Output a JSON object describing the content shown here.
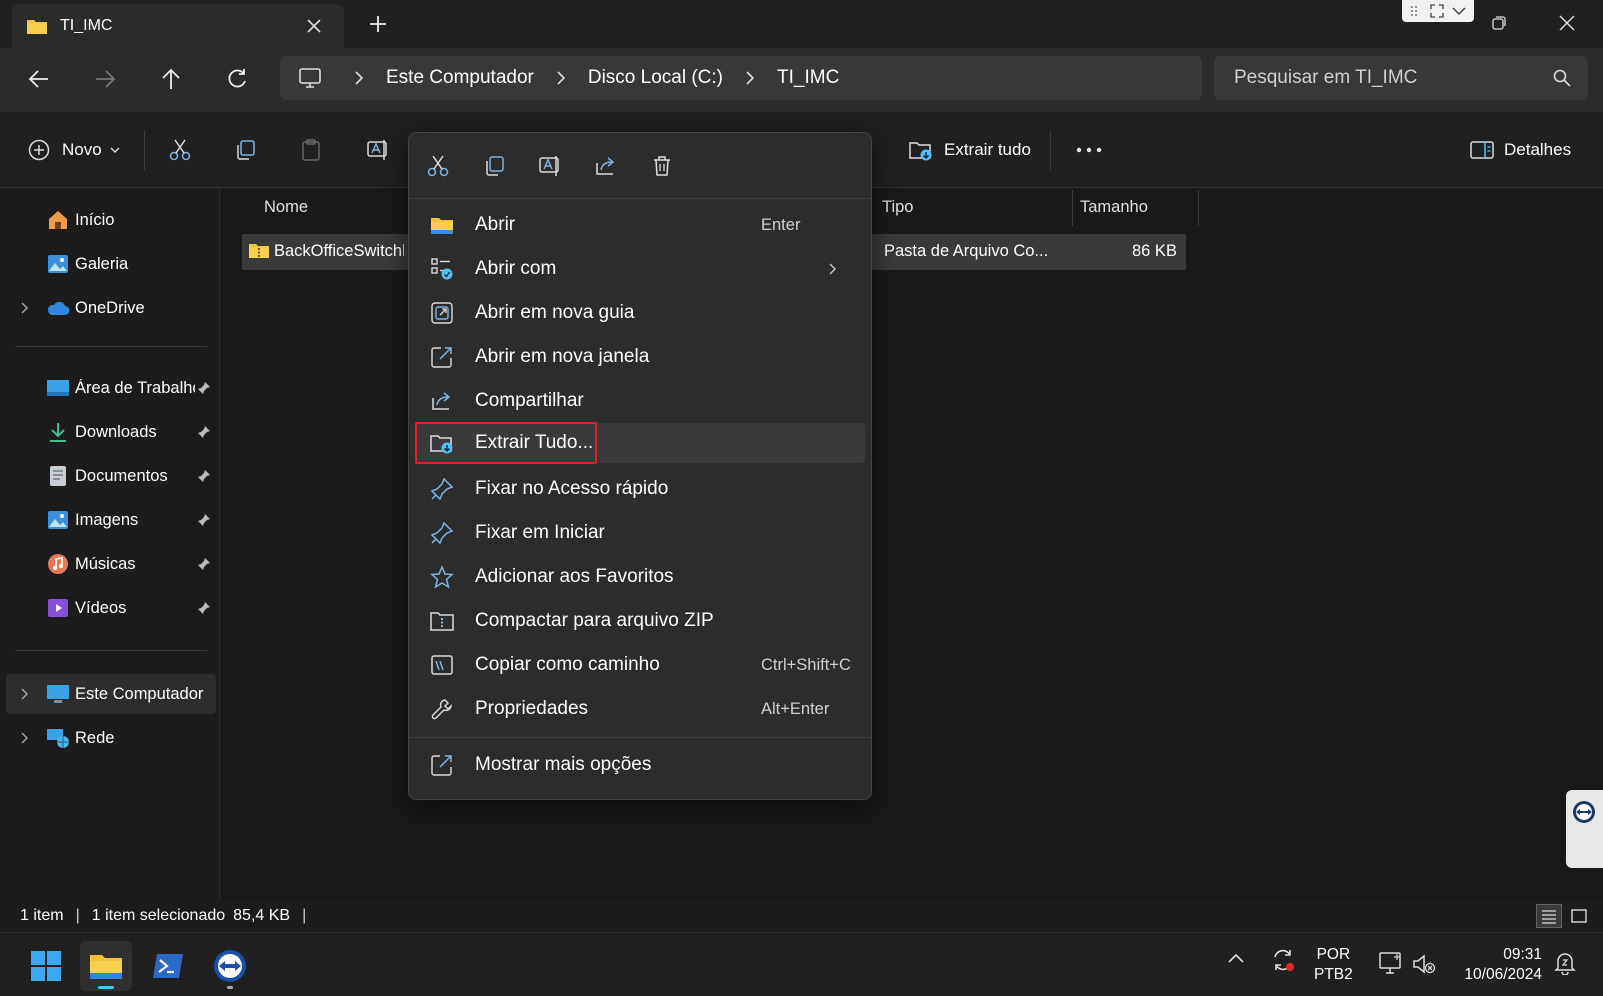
{
  "window": {
    "tab_title": "TI_IMC"
  },
  "address": {
    "crumbs": [
      "Este Computador",
      "Disco Local (C:)",
      "TI_IMC"
    ],
    "search_placeholder": "Pesquisar em TI_IMC"
  },
  "commandbar": {
    "new_label": "Novo",
    "extract_all_label": "Extrair tudo",
    "details_label": "Detalhes"
  },
  "sidebar": {
    "items": [
      {
        "label": "Início"
      },
      {
        "label": "Galeria"
      },
      {
        "label": "OneDrive"
      },
      {
        "label": "Área de Trabalho"
      },
      {
        "label": "Downloads"
      },
      {
        "label": "Documentos"
      },
      {
        "label": "Imagens"
      },
      {
        "label": "Músicas"
      },
      {
        "label": "Vídeos"
      },
      {
        "label": "Este Computador"
      },
      {
        "label": "Rede"
      }
    ]
  },
  "filelist": {
    "columns": [
      "Nome",
      "Tipo",
      "Tamanho"
    ],
    "rows": [
      {
        "name": "BackOfficeSwitchb",
        "type": "Pasta de Arquivo Co...",
        "size": "86 KB"
      }
    ]
  },
  "context_menu": {
    "items": [
      {
        "label": "Abrir",
        "shortcut": "Enter",
        "icon": "folder-icon"
      },
      {
        "label": "Abrir com",
        "shortcut": "",
        "icon": "open-with-icon"
      },
      {
        "label": "Abrir em nova guia",
        "shortcut": "",
        "icon": "new-tab-icon"
      },
      {
        "label": "Abrir em nova janela",
        "shortcut": "",
        "icon": "new-window-icon"
      },
      {
        "label": "Compartilhar",
        "shortcut": "",
        "icon": "share-icon"
      },
      {
        "label": "Extrair Tudo...",
        "shortcut": "",
        "icon": "extract-icon"
      },
      {
        "label": "Fixar no Acesso rápido",
        "shortcut": "",
        "icon": "pin-icon"
      },
      {
        "label": "Fixar em Iniciar",
        "shortcut": "",
        "icon": "pin-start-icon"
      },
      {
        "label": "Adicionar aos Favoritos",
        "shortcut": "",
        "icon": "star-icon"
      },
      {
        "label": "Compactar para arquivo ZIP",
        "shortcut": "",
        "icon": "zip-icon"
      },
      {
        "label": "Copiar como caminho",
        "shortcut": "Ctrl+Shift+C",
        "icon": "copy-path-icon"
      },
      {
        "label": "Propriedades",
        "shortcut": "Alt+Enter",
        "icon": "wrench-icon"
      },
      {
        "label": "Mostrar mais opções",
        "shortcut": "",
        "icon": "more-options-icon"
      }
    ]
  },
  "statusbar": {
    "count": "1 item",
    "selected": "1 item selecionado",
    "size": "85,4 KB"
  },
  "taskbar": {
    "lang_top": "POR",
    "lang_bottom": "PTB2",
    "time": "09:31",
    "date": "10/06/2024"
  },
  "colors": {
    "accent_blue": "#4cc2ff",
    "folder_yellow": "#f3c13a",
    "highlight_red": "#e0202a"
  }
}
